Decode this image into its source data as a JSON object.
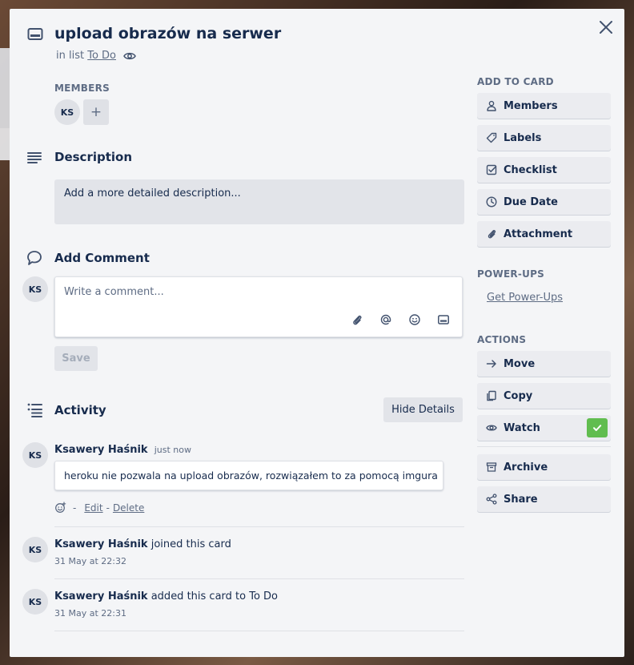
{
  "card": {
    "title": "upload obrazów na serwer",
    "in_list_prefix": "in list",
    "list_name": "To Do"
  },
  "members": {
    "label": "MEMBERS",
    "avatar": "KS",
    "add": "+"
  },
  "description": {
    "title": "Description",
    "placeholder": "Add a more detailed description..."
  },
  "comment": {
    "title": "Add Comment",
    "avatar": "KS",
    "placeholder": "Write a comment...",
    "save_label": "Save",
    "icons": [
      "paperclip-icon",
      "at-mention-icon",
      "emoji-icon",
      "card-icon"
    ]
  },
  "activity": {
    "title": "Activity",
    "hide_details": "Hide Details",
    "items": [
      {
        "avatar": "KS",
        "user": "Ksawery Haśnik",
        "time": "just now",
        "comment": "heroku nie pozwala na upload obrazów, rozwiązałem to za pomocą imgura",
        "separator": "-",
        "edit": "Edit",
        "dash": "-",
        "delete": "Delete"
      },
      {
        "avatar": "KS",
        "user": "Ksawery Haśnik",
        "action": "joined this card",
        "time": "31 May at 22:32"
      },
      {
        "avatar": "KS",
        "user": "Ksawery Haśnik",
        "action": "added this card to To Do",
        "time": "31 May at 22:31"
      }
    ]
  },
  "sidebar": {
    "add_to_card_label": "ADD TO CARD",
    "add_to_card": [
      {
        "label": "Members",
        "icon": "person-icon"
      },
      {
        "label": "Labels",
        "icon": "tag-icon"
      },
      {
        "label": "Checklist",
        "icon": "checklist-icon"
      },
      {
        "label": "Due Date",
        "icon": "clock-icon"
      },
      {
        "label": "Attachment",
        "icon": "paperclip-icon"
      }
    ],
    "power_ups_label": "POWER-UPS",
    "get_power_ups": "Get Power-Ups",
    "actions_label": "ACTIONS",
    "actions": [
      {
        "label": "Move",
        "icon": "arrow-right-icon"
      },
      {
        "label": "Copy",
        "icon": "copy-icon"
      },
      {
        "label": "Watch",
        "icon": "eye-icon",
        "checked": true
      },
      {
        "label": "Archive",
        "icon": "archive-icon"
      },
      {
        "label": "Share",
        "icon": "share-icon"
      }
    ]
  },
  "colors": {
    "accent_green": "#61bd4f",
    "text": "#172b4d",
    "muted": "#5e6c84",
    "modal_bg": "#f4f5f7"
  }
}
